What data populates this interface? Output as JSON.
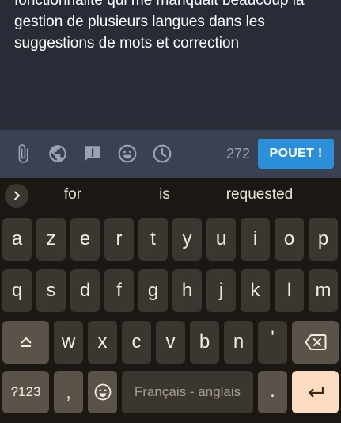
{
  "compose": {
    "text": "fonctionnalité qui me manquait beaucoup la gestion de plusieurs langues dans les suggestions de mots et correction"
  },
  "toolbar": {
    "icons": [
      "paperclip-icon",
      "globe-icon",
      "content-warning-icon",
      "emoji-icon",
      "clock-icon"
    ],
    "char_count": "272",
    "toot_label": "POUET !"
  },
  "suggestions": {
    "items": [
      "for",
      "is",
      "requested"
    ]
  },
  "keyboard": {
    "row1": [
      "a",
      "z",
      "e",
      "r",
      "t",
      "y",
      "u",
      "i",
      "o",
      "p"
    ],
    "row2": [
      "q",
      "s",
      "d",
      "f",
      "g",
      "h",
      "j",
      "k",
      "l",
      "m"
    ],
    "row3": [
      "w",
      "x",
      "c",
      "v",
      "b",
      "n",
      "'"
    ],
    "symbols_label": "?123",
    "comma_label": ",",
    "space_label": "Français - anglais",
    "period_label": "."
  },
  "colors": {
    "compose_bg": "#282c37",
    "toolbar_bg": "#3a4252",
    "accent": "#2b90d9",
    "keyboard_bg": "#1b1712",
    "enter_key": "#fcddc2"
  }
}
